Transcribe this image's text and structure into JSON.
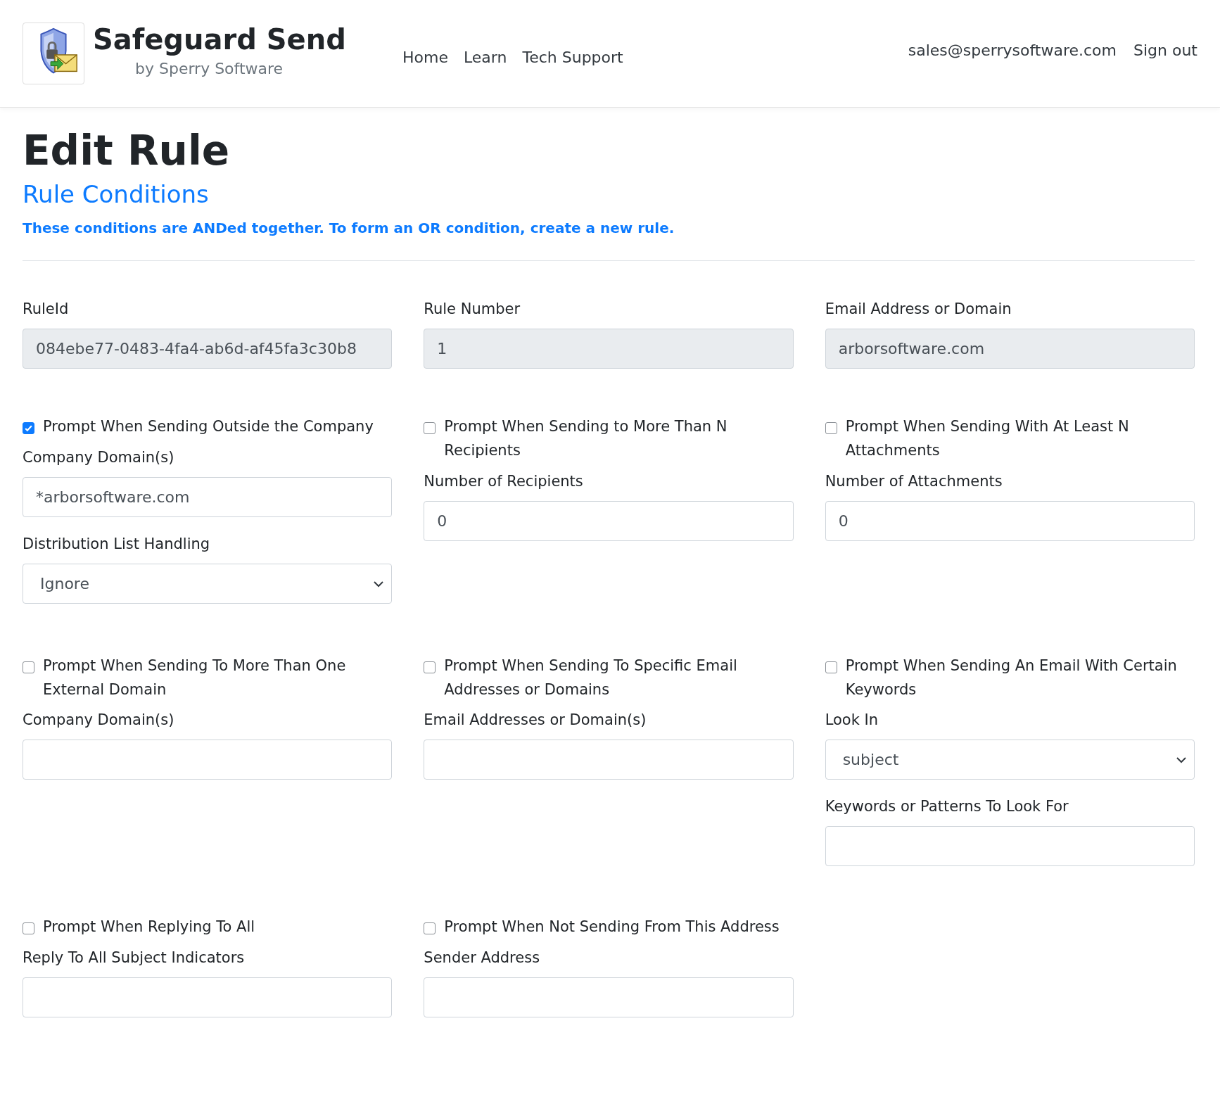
{
  "header": {
    "brand_title": "Safeguard Send",
    "brand_subtitle": "by Sperry Software",
    "nav": [
      {
        "label": "Home"
      },
      {
        "label": "Learn"
      },
      {
        "label": "Tech Support"
      }
    ],
    "account": [
      {
        "label": "sales@sperrysoftware.com"
      },
      {
        "label": "Sign out"
      }
    ]
  },
  "page_title": "Edit Rule",
  "section": {
    "title": "Rule Conditions",
    "note": "These conditions are ANDed together. To form an OR condition, create a new rule."
  },
  "identity_fields": [
    {
      "label": "RuleId",
      "value": "084ebe77-0483-4fa4-ab6d-af45fa3c30b8",
      "readonly": true
    },
    {
      "label": "Rule Number",
      "value": "1",
      "readonly": true
    },
    {
      "label": "Email Address or Domain",
      "value": "arborsoftware.com",
      "readonly": true
    }
  ],
  "condition_rows": [
    [
      {
        "label": "Prompt When Sending Outside the Company",
        "checked": true,
        "fields": [
          {
            "kind": "input",
            "label": "Company Domain(s)",
            "value": "*arborsoftware.com"
          },
          {
            "kind": "select",
            "label": "Distribution List Handling",
            "value": "Ignore"
          }
        ]
      },
      {
        "label": "Prompt When Sending to More Than N Recipients",
        "checked": false,
        "fields": [
          {
            "kind": "input",
            "label": "Number of Recipients",
            "value": "0"
          }
        ]
      },
      {
        "label": "Prompt When Sending With At Least N Attachments",
        "checked": false,
        "fields": [
          {
            "kind": "input",
            "label": "Number of Attachments",
            "value": "0"
          }
        ]
      }
    ],
    [
      {
        "label": "Prompt When Sending To More Than One External Domain",
        "checked": false,
        "fields": [
          {
            "kind": "input",
            "label": "Company Domain(s)"
          }
        ]
      },
      {
        "label": "Prompt When Sending To Specific Email Addresses or Domains",
        "checked": false,
        "fields": [
          {
            "kind": "input",
            "label": "Email Addresses or Domain(s)"
          }
        ]
      },
      {
        "label": "Prompt When Sending An Email With Certain Keywords",
        "checked": false,
        "fields": [
          {
            "kind": "select",
            "label": "Look In",
            "value": "subject"
          },
          {
            "kind": "input",
            "label": "Keywords or Patterns To Look For"
          }
        ]
      }
    ],
    [
      {
        "label": "Prompt When Replying To All",
        "checked": false,
        "fields": [
          {
            "kind": "input",
            "label": "Reply To All Subject Indicators"
          }
        ]
      },
      {
        "label": "Prompt When Not Sending From This Address",
        "checked": false,
        "fields": [
          {
            "kind": "input",
            "label": "Sender Address"
          }
        ]
      }
    ]
  ]
}
